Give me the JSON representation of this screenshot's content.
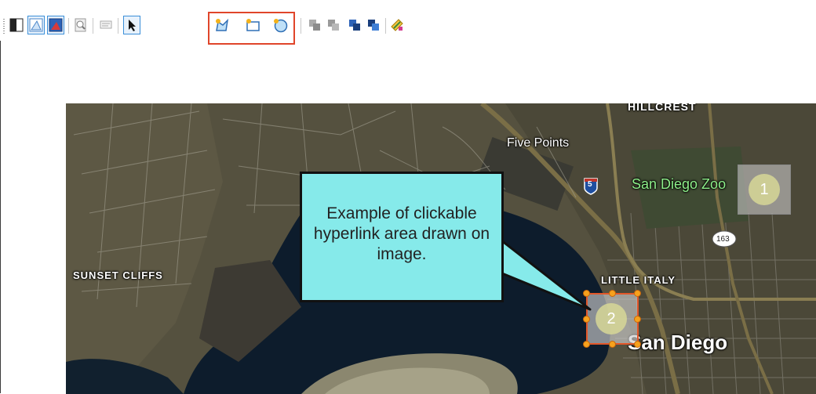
{
  "toolbar": {
    "buttons": [
      {
        "id": "contrast",
        "icon": "contrast-icon"
      },
      {
        "id": "image-layer-light",
        "icon": "image-layer-icon"
      },
      {
        "id": "image-layer-dark",
        "icon": "image-layer-filled-icon"
      },
      {
        "id": "zoom-page",
        "icon": "zoom-icon"
      },
      {
        "id": "comment",
        "icon": "comment-icon"
      },
      {
        "id": "select-pointer",
        "icon": "pointer-icon"
      },
      {
        "id": "polygon-hotspot",
        "icon": "polygon-hotspot-icon"
      },
      {
        "id": "rectangle-hotspot",
        "icon": "rectangle-hotspot-icon"
      },
      {
        "id": "circle-hotspot",
        "icon": "circle-hotspot-icon"
      },
      {
        "id": "bring-front",
        "icon": "bring-front-icon"
      },
      {
        "id": "send-back",
        "icon": "send-back-icon"
      },
      {
        "id": "bring-forward",
        "icon": "bring-forward-icon"
      },
      {
        "id": "send-backward",
        "icon": "send-backward-icon"
      },
      {
        "id": "edit-link",
        "icon": "edit-link-icon"
      }
    ]
  },
  "map": {
    "labels": {
      "hillcrest": "HILLCREST",
      "five_points": "Five Points",
      "zoo": "San Diego Zoo",
      "sunset_cliffs": "SUNSET CLIFFS",
      "little_italy": "LITTLE ITALY",
      "san_diego": "San Diego",
      "route_5": "5",
      "route_163": "163"
    },
    "hotspots": [
      {
        "number": "1"
      },
      {
        "number": "2"
      }
    ]
  },
  "callout": {
    "text": "Example of clickable hyperlink area drawn on image."
  },
  "colors": {
    "highlight_red": "#e0452a",
    "callout_fill": "#86eaea",
    "handle_orange": "#f6a21d"
  }
}
